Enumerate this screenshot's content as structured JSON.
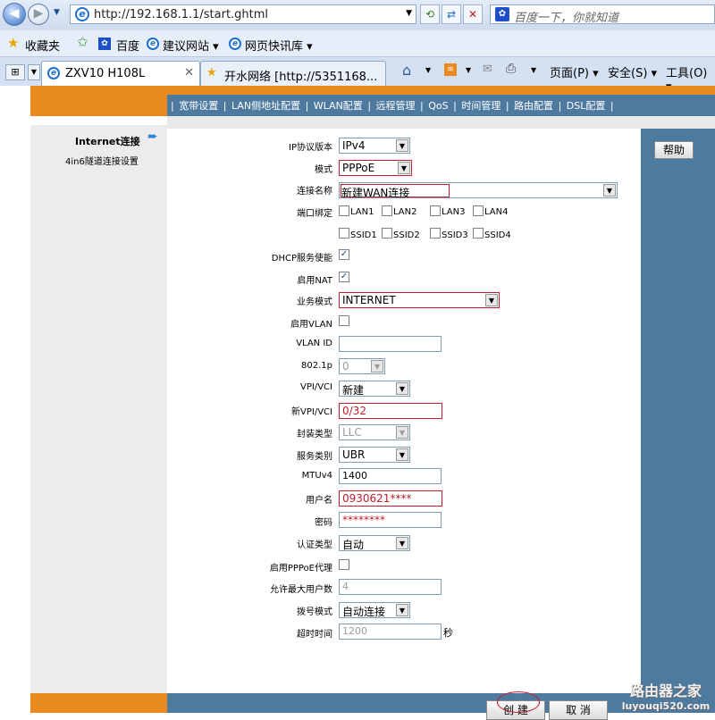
{
  "browser": {
    "url": "http://192.168.1.1/start.ghtml",
    "search_placeholder": "百度一下，你就知道",
    "favorites": {
      "label": "收藏夹",
      "items": [
        "百度",
        "建议网站 ▾",
        "网页快讯库 ▾"
      ]
    },
    "tabs": [
      {
        "label": "ZXV10 H108L",
        "active": true
      },
      {
        "label": "开水网络 [http://5351168...",
        "active": false
      }
    ],
    "command_bar": {
      "page": "页面(P) ▾",
      "safety": "安全(S) ▾",
      "tools": "工具(O) ▾"
    }
  },
  "nav": {
    "items": [
      "宽带设置",
      "LAN侧地址配置",
      "WLAN配置",
      "远程管理",
      "QoS",
      "时间管理",
      "路由配置",
      "DSL配置"
    ],
    "separator": "|"
  },
  "sidebar": {
    "active_item": "Internet连接",
    "items": [
      "4in6隧道连接设置"
    ]
  },
  "help_button": "帮助",
  "form": {
    "ip_version": {
      "label": "IP协议版本",
      "value": "IPv4"
    },
    "mode": {
      "label": "模式",
      "value": "PPPoE"
    },
    "conn_name": {
      "label": "连接名称",
      "value": "新建WAN连接"
    },
    "port_binding": {
      "label": "端口绑定",
      "options": [
        "LAN1",
        "LAN2",
        "LAN3",
        "LAN4",
        "SSID1",
        "SSID2",
        "SSID3",
        "SSID4"
      ]
    },
    "dhcp": {
      "label": "DHCP服务使能",
      "checked": true
    },
    "nat": {
      "label": "启用NAT",
      "checked": true
    },
    "service_mode": {
      "label": "业务模式",
      "value": "INTERNET"
    },
    "vlan_enable": {
      "label": "启用VLAN",
      "checked": false
    },
    "vlan_id": {
      "label": "VLAN ID",
      "value": ""
    },
    "p8021": {
      "label": "802.1p",
      "value": "0"
    },
    "vpi_vci": {
      "label": "VPI/VCI",
      "value": "新建"
    },
    "new_vpi_vci": {
      "label": "新VPI/VCI",
      "value": "0/32"
    },
    "encap": {
      "label": "封装类型",
      "value": "LLC"
    },
    "service_class": {
      "label": "服务类别",
      "value": "UBR"
    },
    "mtu": {
      "label": "MTUv4",
      "value": "1400"
    },
    "username": {
      "label": "用户名",
      "value": "0930621****"
    },
    "password": {
      "label": "密码",
      "value": "********"
    },
    "auth_type": {
      "label": "认证类型",
      "value": "自动"
    },
    "pppoe_proxy": {
      "label": "启用PPPoE代理",
      "checked": false
    },
    "max_users": {
      "label": "允许最大用户数",
      "value": "4"
    },
    "dial_mode": {
      "label": "拨号模式",
      "value": "自动连接"
    },
    "timeout": {
      "label": "超时时间",
      "value": "1200",
      "unit": "秒"
    }
  },
  "buttons": {
    "create": "创 建",
    "cancel": "取 消"
  },
  "watermark": {
    "title": "路由器之家",
    "url": "luyouqi520.com"
  }
}
